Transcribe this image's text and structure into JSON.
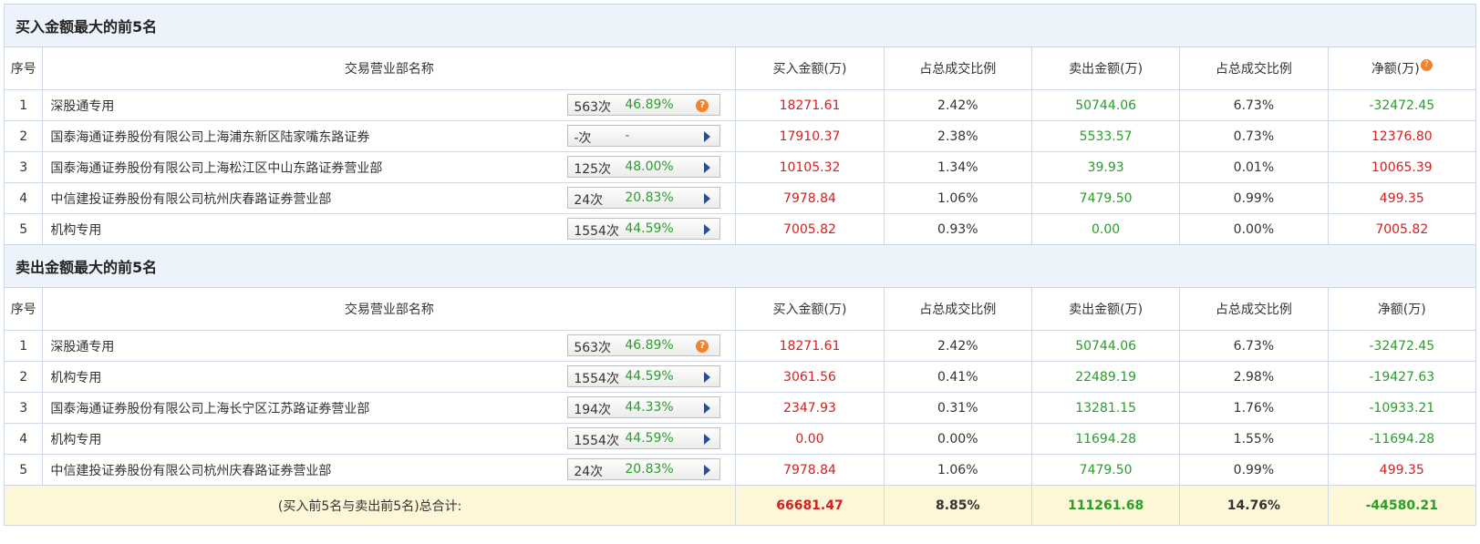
{
  "buy_section": {
    "title": "买入金额最大的前5名",
    "headers": {
      "seq": "序号",
      "name": "交易营业部名称",
      "buy": "买入金额(万)",
      "buy_ratio": "占总成交比例",
      "sell": "卖出金额(万)",
      "sell_ratio": "占总成交比例",
      "net": "净额(万)"
    },
    "rows": [
      {
        "seq": "1",
        "name": "深股通专用",
        "count": "563次",
        "pct": "46.89%",
        "btn": "question",
        "buy": "18271.61",
        "buy_ratio": "2.42%",
        "sell": "50744.06",
        "sell_ratio": "6.73%",
        "net": "-32472.45",
        "net_color": "green"
      },
      {
        "seq": "2",
        "name": "国泰海通证券股份有限公司上海浦东新区陆家嘴东路证券",
        "count": "-次",
        "pct": "-",
        "btn": "arrow",
        "buy": "17910.37",
        "buy_ratio": "2.38%",
        "sell": "5533.57",
        "sell_ratio": "0.73%",
        "net": "12376.80",
        "net_color": "red"
      },
      {
        "seq": "3",
        "name": "国泰海通证券股份有限公司上海松江区中山东路证券营业部",
        "count": "125次",
        "pct": "48.00%",
        "btn": "arrow",
        "buy": "10105.32",
        "buy_ratio": "1.34%",
        "sell": "39.93",
        "sell_ratio": "0.01%",
        "net": "10065.39",
        "net_color": "red"
      },
      {
        "seq": "4",
        "name": "中信建投证券股份有限公司杭州庆春路证券营业部",
        "count": "24次",
        "pct": "20.83%",
        "btn": "arrow",
        "buy": "7978.84",
        "buy_ratio": "1.06%",
        "sell": "7479.50",
        "sell_ratio": "0.99%",
        "net": "499.35",
        "net_color": "red"
      },
      {
        "seq": "5",
        "name": "机构专用",
        "count": "1554次",
        "pct": "44.59%",
        "btn": "arrow",
        "buy": "7005.82",
        "buy_ratio": "0.93%",
        "sell": "0.00",
        "sell_ratio": "0.00%",
        "net": "7005.82",
        "net_color": "red"
      }
    ]
  },
  "sell_section": {
    "title": "卖出金额最大的前5名",
    "headers": {
      "seq": "序号",
      "name": "交易营业部名称",
      "buy": "买入金额(万)",
      "buy_ratio": "占总成交比例",
      "sell": "卖出金额(万)",
      "sell_ratio": "占总成交比例",
      "net": "净额(万)"
    },
    "rows": [
      {
        "seq": "1",
        "name": "深股通专用",
        "count": "563次",
        "pct": "46.89%",
        "btn": "question",
        "buy": "18271.61",
        "buy_ratio": "2.42%",
        "sell": "50744.06",
        "sell_ratio": "6.73%",
        "net": "-32472.45",
        "net_color": "green"
      },
      {
        "seq": "2",
        "name": "机构专用",
        "count": "1554次",
        "pct": "44.59%",
        "btn": "arrow",
        "buy": "3061.56",
        "buy_ratio": "0.41%",
        "sell": "22489.19",
        "sell_ratio": "2.98%",
        "net": "-19427.63",
        "net_color": "green"
      },
      {
        "seq": "3",
        "name": "国泰海通证券股份有限公司上海长宁区江苏路证券营业部",
        "count": "194次",
        "pct": "44.33%",
        "btn": "arrow",
        "buy": "2347.93",
        "buy_ratio": "0.31%",
        "sell": "13281.15",
        "sell_ratio": "1.76%",
        "net": "-10933.21",
        "net_color": "green"
      },
      {
        "seq": "4",
        "name": "机构专用",
        "count": "1554次",
        "pct": "44.59%",
        "btn": "arrow",
        "buy": "0.00",
        "buy_ratio": "0.00%",
        "sell": "11694.28",
        "sell_ratio": "1.55%",
        "net": "-11694.28",
        "net_color": "green"
      },
      {
        "seq": "5",
        "name": "中信建投证券股份有限公司杭州庆春路证券营业部",
        "count": "24次",
        "pct": "20.83%",
        "btn": "arrow",
        "buy": "7978.84",
        "buy_ratio": "1.06%",
        "sell": "7479.50",
        "sell_ratio": "0.99%",
        "net": "499.35",
        "net_color": "red"
      }
    ]
  },
  "total": {
    "label": "(买入前5名与卖出前5名)总合计:",
    "buy": "66681.47",
    "buy_ratio": "8.85%",
    "sell": "111261.68",
    "sell_ratio": "14.76%",
    "net": "-44580.21"
  },
  "icons": {
    "question_glyph": "?"
  },
  "colors": {
    "red": "#d42020",
    "green": "#2a9d2a",
    "section_bg": "#edf3fa",
    "total_bg": "#fdf6d7",
    "border": "#cfd9e6",
    "question_badge": "#f0832b"
  }
}
